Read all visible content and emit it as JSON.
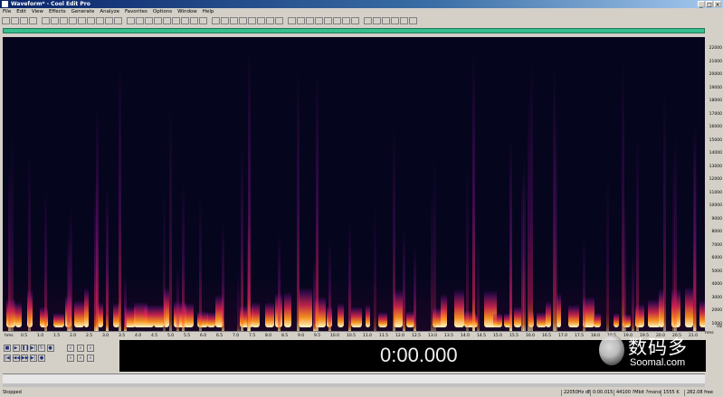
{
  "window": {
    "title": "Waveform* - Cool Edit Pro",
    "buttons": [
      "_",
      "□",
      "×"
    ]
  },
  "menu": [
    "File",
    "Edit",
    "View",
    "Effects",
    "Generate",
    "Analyze",
    "Favorites",
    "Options",
    "Window",
    "Help"
  ],
  "time_display": "0:00.000",
  "y_axis_ticks": [
    "22000",
    "21000",
    "20000",
    "19000",
    "18000",
    "17000",
    "16000",
    "15000",
    "14000",
    "13000",
    "12000",
    "11000",
    "10000",
    "9000",
    "8000",
    "7000",
    "6000",
    "5000",
    "4000",
    "3000",
    "2000",
    "1000"
  ],
  "y_axis_unit": "Hz",
  "x_axis_ticks": [
    "hms",
    "0.5",
    "1.0",
    "1.5",
    "2.0",
    "2.5",
    "3.0",
    "3.5",
    "4.0",
    "4.5",
    "5.0",
    "5.5",
    "6.0",
    "6.5",
    "7.0",
    "7.5",
    "8.0",
    "8.5",
    "9.0",
    "9.5",
    "10.0",
    "10.5",
    "11.0",
    "11.5",
    "12.0",
    "12.5",
    "13.0",
    "13.5",
    "14.0",
    "14.5",
    "15.0",
    "15.5",
    "16.0",
    "16.5",
    "17.0",
    "17.5",
    "18.0",
    "18.5",
    "19.0",
    "19.5",
    "20.0",
    "20.5",
    "21.0"
  ],
  "x_axis_unit": "hms",
  "status": {
    "state": "Stopped",
    "cells": [
      "22050Hz dB",
      "0:00.015",
      "44100 ?Mbit ?mono",
      "1555 K",
      "282.08 free"
    ]
  },
  "watermark": {
    "cn": "数码多",
    "en": "Soomal.com"
  },
  "colors": {
    "overview": "#37c08f",
    "spectro_bg": "#05051e",
    "time_bg": "#000000"
  },
  "icons": {
    "transport": [
      "stop-icon",
      "play-icon",
      "pause-icon",
      "play-to-end-icon",
      "loop-icon",
      "record-icon",
      "go-start-icon",
      "rewind-icon",
      "fast-forward-icon",
      "go-end-icon",
      "record-dot-icon"
    ],
    "zoom": [
      "zoom-in-full-icon",
      "zoom-out-full-icon",
      "zoom-in-vert-icon",
      "zoom-in-icon",
      "zoom-out-icon",
      "zoom-sel-icon"
    ]
  }
}
